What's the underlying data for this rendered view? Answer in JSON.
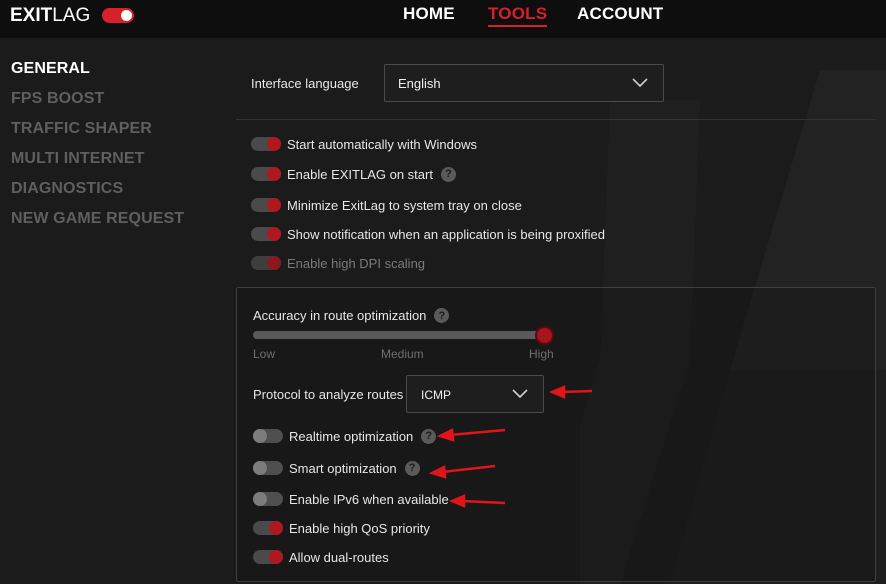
{
  "brand": {
    "logo_bold": "EXIT",
    "logo_light": "LAG",
    "accent_color": "#d8202a"
  },
  "nav": [
    {
      "label": "HOME",
      "active": false
    },
    {
      "label": "TOOLS",
      "active": true
    },
    {
      "label": "ACCOUNT",
      "active": false
    }
  ],
  "sidebar": [
    {
      "label": "GENERAL",
      "active": true
    },
    {
      "label": "FPS BOOST",
      "active": false
    },
    {
      "label": "TRAFFIC SHAPER",
      "active": false
    },
    {
      "label": "MULTI INTERNET",
      "active": false
    },
    {
      "label": "DIAGNOSTICS",
      "active": false
    },
    {
      "label": "NEW GAME REQUEST",
      "active": false
    }
  ],
  "language": {
    "label": "Interface language",
    "value": "English"
  },
  "options": [
    {
      "label": "Start automatically with Windows",
      "on": true,
      "help": false,
      "disabled": false
    },
    {
      "label": "Enable EXITLAG on start",
      "on": true,
      "help": true,
      "disabled": false
    },
    {
      "label": "Minimize ExitLag to system tray on close",
      "on": true,
      "help": false,
      "disabled": false
    },
    {
      "label": "Show notification when an application is being proxified",
      "on": true,
      "help": false,
      "disabled": false
    },
    {
      "label": "Enable high DPI scaling",
      "on": true,
      "help": false,
      "disabled": true
    }
  ],
  "accuracy": {
    "label": "Accuracy in route optimization",
    "ticks": [
      "Low",
      "Medium",
      "High"
    ],
    "value": "High",
    "level": 1.0
  },
  "protocol": {
    "label": "Protocol to analyze routes",
    "value": "ICMP"
  },
  "route_options": [
    {
      "label": "Realtime optimization",
      "on": false,
      "help": true
    },
    {
      "label": "Smart optimization",
      "on": false,
      "help": true
    },
    {
      "label": "Enable IPv6 when available",
      "on": false,
      "help": false
    },
    {
      "label": "Enable high QoS priority",
      "on": true,
      "help": false
    },
    {
      "label": "Allow dual-routes",
      "on": true,
      "help": false
    }
  ],
  "help_glyph": "?"
}
